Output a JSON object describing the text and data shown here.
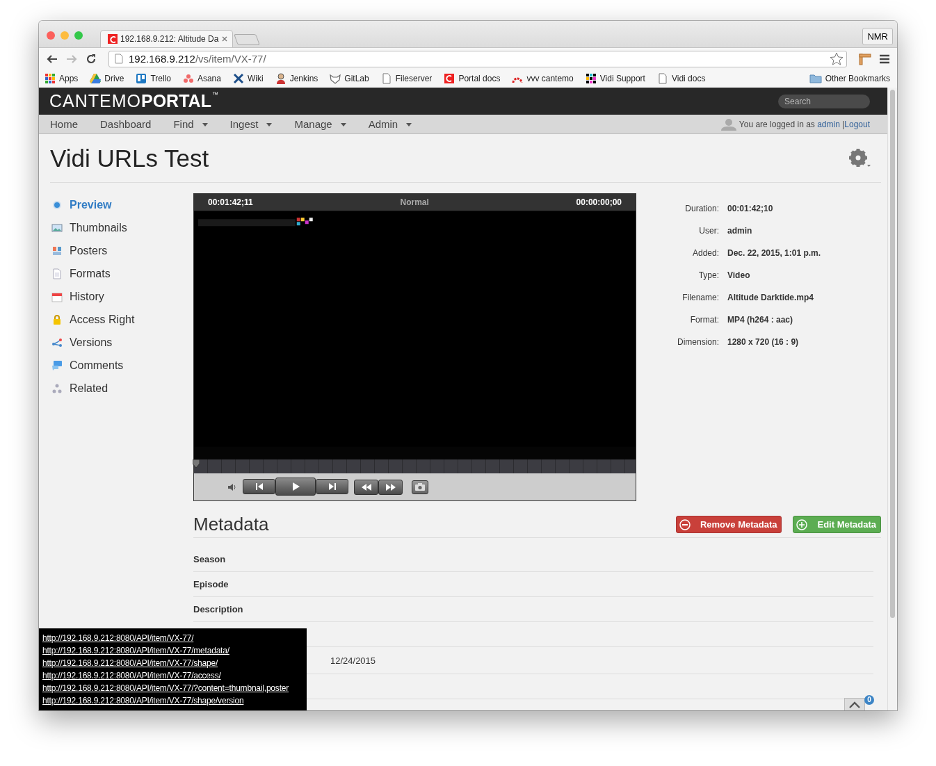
{
  "browser": {
    "tab_title": "192.168.9.212: Altitude Da",
    "profile": "NMR",
    "url_host": "192.168.9.212",
    "url_path": "/vs/item/VX-77/",
    "bookmarks": [
      {
        "label": "Apps"
      },
      {
        "label": "Drive"
      },
      {
        "label": "Trello"
      },
      {
        "label": "Asana"
      },
      {
        "label": "Wiki"
      },
      {
        "label": "Jenkins"
      },
      {
        "label": "GitLab"
      },
      {
        "label": "Fileserver"
      },
      {
        "label": "Portal docs"
      },
      {
        "label": "vvv cantemo"
      },
      {
        "label": "Vidi Support"
      },
      {
        "label": "Vidi docs"
      }
    ],
    "other_bookmarks": "Other Bookmarks"
  },
  "app": {
    "logo_light": "CANTEMO",
    "logo_bold": "PORTAL",
    "logo_mark": "™",
    "search_placeholder": "Search"
  },
  "nav": [
    {
      "label": "Home",
      "dropdown": false
    },
    {
      "label": "Dashboard",
      "dropdown": false
    },
    {
      "label": "Find",
      "dropdown": true
    },
    {
      "label": "Ingest",
      "dropdown": true
    },
    {
      "label": "Manage",
      "dropdown": true
    },
    {
      "label": "Admin",
      "dropdown": true
    }
  ],
  "user": {
    "text": "You are logged in as",
    "name": "admin",
    "separator": "|",
    "logout": "Logout"
  },
  "page_title": "Vidi URLs Test",
  "sidebar": [
    {
      "label": "Preview",
      "selected": true
    },
    {
      "label": "Thumbnails",
      "selected": false
    },
    {
      "label": "Posters",
      "selected": false
    },
    {
      "label": "Formats",
      "selected": false
    },
    {
      "label": "History",
      "selected": false
    },
    {
      "label": "Access Right",
      "selected": false
    },
    {
      "label": "Versions",
      "selected": false
    },
    {
      "label": "Comments",
      "selected": false
    },
    {
      "label": "Related",
      "selected": false
    }
  ],
  "player": {
    "timecode": "00:01:42;11",
    "mode": "Normal",
    "position": "00:00:00;00",
    "seek": {
      "level": 0
    }
  },
  "details": [
    {
      "label": "Duration:",
      "value": "00:01:42;10"
    },
    {
      "label": "User:",
      "value": "admin"
    },
    {
      "label": "Added:",
      "value": "Dec. 22, 2015, 1:01 p.m."
    },
    {
      "label": "Type:",
      "value": "Video"
    },
    {
      "label": "Filename:",
      "value": "Altitude Darktide.mp4"
    },
    {
      "label": "Format:",
      "value": "MP4 (h264 : aac)"
    },
    {
      "label": "Dimension:",
      "value": "1280 x 720 (16 : 9)"
    }
  ],
  "metadata": {
    "title": "Metadata",
    "buttons": [
      {
        "label": "Remove Metadata",
        "kind": "remove"
      },
      {
        "label": "Edit Metadata",
        "kind": "add"
      }
    ],
    "rows": [
      {
        "label": "Season"
      },
      {
        "label": "Episode"
      },
      {
        "label": "Description"
      },
      {},
      {
        "value": "12/24/2015"
      },
      {}
    ]
  },
  "link_overlay": {
    "links": [
      "http://192.168.9.212:8080/API/item/VX-77/",
      "http://192.168.9.212:8080/API/item/VX-77/metadata/",
      "http://192.168.9.212:8080/API/item/VX-77/shape/",
      "http://192.168.9.212:8080/API/item/VX-77/access/",
      "http://192.168.9.212:8080/API/item/VX-77/?content=thumbnail,poster",
      "http://192.168.9.212:8080/API/item/VX-77/shape/version"
    ]
  },
  "scroll_top": {
    "badge": "0"
  }
}
